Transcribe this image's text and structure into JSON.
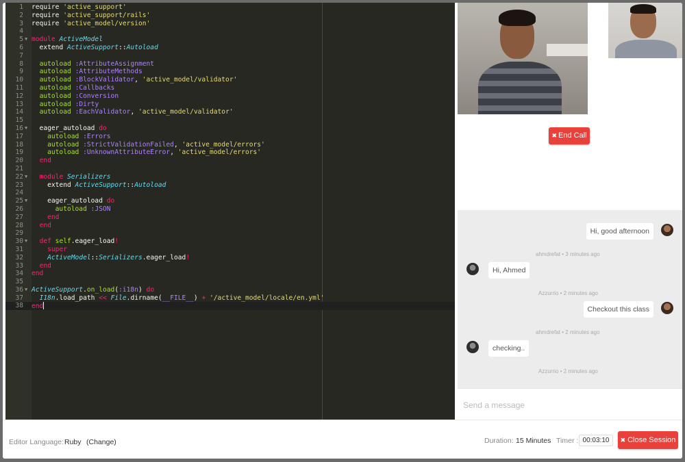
{
  "editor": {
    "language": "Ruby",
    "lines": [
      {
        "n": "1",
        "html": "require <span class='s'>'active_support'</span>"
      },
      {
        "n": "2",
        "html": "require <span class='s'>'active_support/rails'</span>"
      },
      {
        "n": "3",
        "html": "require <span class='s'>'active_model/version'</span>"
      },
      {
        "n": "4",
        "html": ""
      },
      {
        "n": "5",
        "fold": true,
        "html": "<span class='k'>module</span> <span class='c'>ActiveModel</span>"
      },
      {
        "n": "6",
        "html": "  extend <span class='c'>ActiveSupport</span>::<span class='c'>Autoload</span>"
      },
      {
        "n": "7",
        "html": ""
      },
      {
        "n": "8",
        "html": "  <span class='f'>autoload</span> <span class='y'>:AttributeAssignment</span>"
      },
      {
        "n": "9",
        "html": "  <span class='f'>autoload</span> <span class='y'>:AttributeMethods</span>"
      },
      {
        "n": "10",
        "html": "  <span class='f'>autoload</span> <span class='y'>:BlockValidator</span>, <span class='s'>'active_model/validator'</span>"
      },
      {
        "n": "11",
        "html": "  <span class='f'>autoload</span> <span class='y'>:Callbacks</span>"
      },
      {
        "n": "12",
        "html": "  <span class='f'>autoload</span> <span class='y'>:Conversion</span>"
      },
      {
        "n": "13",
        "html": "  <span class='f'>autoload</span> <span class='y'>:Dirty</span>"
      },
      {
        "n": "14",
        "html": "  <span class='f'>autoload</span> <span class='y'>:EachValidator</span>, <span class='s'>'active_model/validator'</span>"
      },
      {
        "n": "15",
        "html": ""
      },
      {
        "n": "16",
        "fold": true,
        "html": "  eager_autoload <span class='k'>do</span>"
      },
      {
        "n": "17",
        "html": "    <span class='f'>autoload</span> <span class='y'>:Errors</span>"
      },
      {
        "n": "18",
        "html": "    <span class='f'>autoload</span> <span class='y'>:StrictValidationFailed</span>, <span class='s'>'active_model/errors'</span>"
      },
      {
        "n": "19",
        "html": "    <span class='f'>autoload</span> <span class='y'>:UnknownAttributeError</span>, <span class='s'>'active_model/errors'</span>"
      },
      {
        "n": "20",
        "html": "  <span class='k'>end</span>"
      },
      {
        "n": "21",
        "html": ""
      },
      {
        "n": "22",
        "fold": true,
        "html": "  <span class='k'>module</span> <span class='c'>Serializers</span>"
      },
      {
        "n": "23",
        "html": "    extend <span class='c'>ActiveSupport</span>::<span class='c'>Autoload</span>"
      },
      {
        "n": "24",
        "html": ""
      },
      {
        "n": "25",
        "fold": true,
        "html": "    eager_autoload <span class='k'>do</span>"
      },
      {
        "n": "26",
        "html": "      <span class='f'>autoload</span> <span class='y'>:JSON</span>"
      },
      {
        "n": "27",
        "html": "    <span class='k'>end</span>"
      },
      {
        "n": "28",
        "html": "  <span class='k'>end</span>"
      },
      {
        "n": "29",
        "html": ""
      },
      {
        "n": "30",
        "fold": true,
        "html": "  <span class='k'>def</span> <span class='f'>self</span>.eager_load<span class='k'>!</span>"
      },
      {
        "n": "31",
        "html": "    <span class='k'>super</span>"
      },
      {
        "n": "32",
        "html": "    <span class='c'>ActiveModel</span>::<span class='c'>Serializers</span>.eager_load<span class='k'>!</span>"
      },
      {
        "n": "33",
        "html": "  <span class='k'>end</span>"
      },
      {
        "n": "34",
        "html": "<span class='k'>end</span>"
      },
      {
        "n": "35",
        "html": ""
      },
      {
        "n": "36",
        "fold": true,
        "html": "<span class='c'>ActiveSupport</span>.<span class='f'>on_load</span>(<span class='y'>:i18n</span>) <span class='k'>do</span>"
      },
      {
        "n": "37",
        "html": "  <span class='c'>I18n</span>.load_path <span class='k'>&lt;&lt;</span> <span class='c'>File</span>.dirname(<span class='y'>__FILE__</span>) <span class='k'>+</span> <span class='s'>'/active_model/locale/en.yml'</span>"
      },
      {
        "n": "38",
        "active": true,
        "html": "<span class='k'>end</span><span class='cursor'></span>"
      }
    ]
  },
  "video": {
    "end_call_label": "End Call"
  },
  "chat": {
    "messages": [
      {
        "side": "right",
        "text": "Hi, good afternoon",
        "meta": "ahmdrefat • 3 minutes ago"
      },
      {
        "side": "left",
        "text": "Hi, Ahmed",
        "meta": "Azzurrio • 2 minutes ago"
      },
      {
        "side": "right",
        "text": "Checkout this class",
        "meta": "ahmdrefat • 2 minutes ago"
      },
      {
        "side": "left",
        "text": "checking..",
        "meta": "Azzurrio • 2 minutes ago"
      }
    ],
    "placeholder": "Send a message"
  },
  "footer": {
    "editor_language_label": "Editor Language:",
    "editor_language_value": "Ruby",
    "change_label": "(Change)",
    "duration_label": "Duration:",
    "duration_value": "15 Minutes",
    "timer_label": "Timer :",
    "timer_value": "00:03:10",
    "close_session_label": "Close Session"
  },
  "colors": {
    "accent_red": "#e8403b",
    "editor_bg": "#272822"
  }
}
